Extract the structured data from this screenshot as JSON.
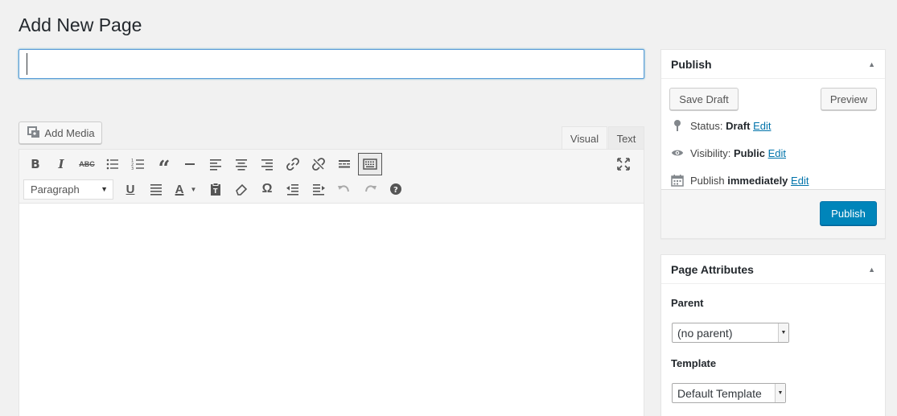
{
  "page": {
    "title": "Add New Page"
  },
  "title_input": {
    "value": "",
    "placeholder": ""
  },
  "editor": {
    "add_media_label": "Add Media",
    "tabs": [
      {
        "label": "Visual",
        "active": true
      },
      {
        "label": "Text",
        "active": false
      }
    ],
    "format_select": "Paragraph",
    "toolbar_row1_icons": [
      "bold-icon",
      "italic-icon",
      "strikethrough-icon",
      "bullet-list-icon",
      "numbered-list-icon",
      "blockquote-icon",
      "horizontal-line-icon",
      "align-left-icon",
      "align-center-icon",
      "align-right-icon",
      "insert-link-icon",
      "unlink-icon",
      "read-more-icon",
      "toolbar-toggle-icon"
    ],
    "toolbar_row2_icons": [
      "underline-icon",
      "justify-icon",
      "text-color-icon",
      "paste-text-icon",
      "clear-formatting-icon",
      "special-character-icon",
      "outdent-icon",
      "indent-icon",
      "undo-icon",
      "redo-icon",
      "help-icon"
    ],
    "fullscreen_icon": "distraction-free-icon"
  },
  "publish": {
    "title": "Publish",
    "save_draft": "Save Draft",
    "preview": "Preview",
    "status_label": "Status:",
    "status_value": "Draft",
    "visibility_label": "Visibility:",
    "visibility_value": "Public",
    "publish_label": "Publish",
    "publish_value": "immediately",
    "edit_link": "Edit",
    "publish_button": "Publish"
  },
  "attributes": {
    "title": "Page Attributes",
    "parent_label": "Parent",
    "parent_value": "(no parent)",
    "template_label": "Template",
    "template_value": "Default Template"
  },
  "colors": {
    "accent": "#0085ba",
    "link": "#0073aa",
    "background": "#f1f1f1"
  }
}
